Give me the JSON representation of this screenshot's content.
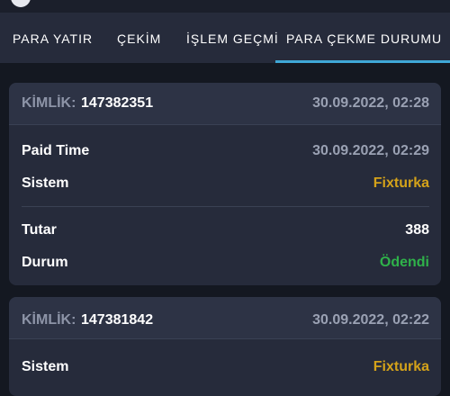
{
  "tabs": [
    {
      "label": "PARA YATIR"
    },
    {
      "label": "ÇEKİM"
    },
    {
      "label": "İŞLEM GEÇMİ"
    },
    {
      "label": "PARA ÇEKME DURUMU"
    }
  ],
  "colors": {
    "accent": "#3fa7d6",
    "system_value": "#d4a21a",
    "status_paid": "#2fb24a"
  },
  "cards": [
    {
      "id_label": "KİMLİK:",
      "id": "147382351",
      "date": "30.09.2022, 02:28",
      "paid_time_label": "Paid Time",
      "paid_time": "30.09.2022, 02:29",
      "system_label": "Sistem",
      "system": "Fixturka",
      "amount_label": "Tutar",
      "amount": "388",
      "status_label": "Durum",
      "status": "Ödendi"
    },
    {
      "id_label": "KİMLİK:",
      "id": "147381842",
      "date": "30.09.2022, 02:22",
      "system_label": "Sistem",
      "system": "Fixturka"
    }
  ]
}
